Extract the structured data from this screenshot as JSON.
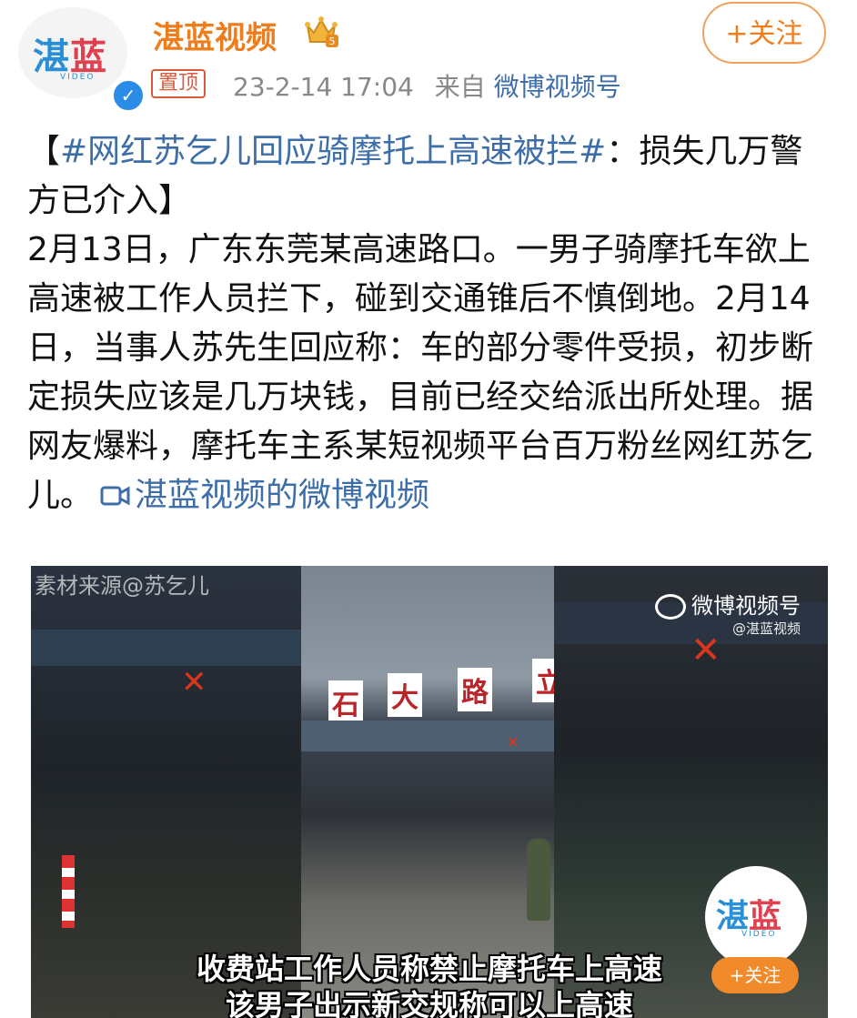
{
  "account": {
    "name": "湛蓝视频",
    "avatar_logo_blue": "湛",
    "avatar_logo_red": "蓝",
    "avatar_sub": "VIDEO",
    "verified_icon": "check-badge-icon",
    "crown_icon": "crown-icon"
  },
  "post_meta": {
    "pinned_label": "置顶",
    "timestamp": "23-2-14 17:04",
    "from_label": "来自",
    "source": "微博视频号"
  },
  "follow_label": "+关注",
  "post": {
    "bracket_open": "【",
    "hashtag": "#网红苏乞儿回应骑摩托上高速被拦#",
    "title_rest": "：损失几万警方已介入】",
    "body": "2月13日，广东东莞某高速路口。一男子骑摩托车欲上高速被工作人员拦下，碰到交通锥后不慎倒地。2月14日，当事人苏先生回应称：车的部分零件受损，初步断定损失应该是几万块钱，目前已经交给派出所处理。据网友爆料，摩托车主系某短视频平台百万粉丝网红苏乞儿。",
    "video_link": "湛蓝视频的微博视频",
    "video_link_icon": "video-camera-icon"
  },
  "video": {
    "source_watermark": "素材来源@苏乞儿",
    "platform_watermark": "微博视频号",
    "platform_sub": "@湛蓝视频",
    "sign_chars": [
      "石",
      "大",
      "路",
      "立"
    ],
    "badge_logo_blue": "湛",
    "badge_logo_red": "蓝",
    "badge_sub": "VIDEO",
    "badge_follow": "+关注",
    "subtitle_line1": "收费站工作人员称禁止摩托车上高速",
    "subtitle_line2": "该男子出示新交规称可以上高速"
  },
  "colors": {
    "brand_orange": "#ee7d1d",
    "link_blue": "#3d6ea8",
    "pin_red": "#d9593d",
    "verify_blue": "#2b8ce8"
  }
}
